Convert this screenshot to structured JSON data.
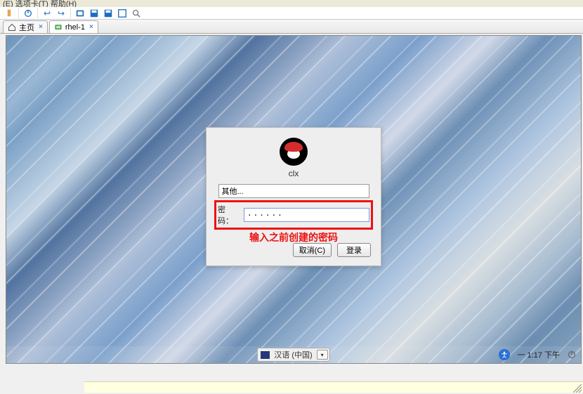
{
  "menubar": {
    "partial_text": "(E)  选项卡(T)  帮助(H)"
  },
  "toolbar": {
    "icons": [
      "pause-icon",
      "divider",
      "power-icon",
      "divider",
      "arrow-left-icon",
      "arrow-right-icon",
      "divider",
      "screenshot-icon",
      "disk-icon",
      "disk-icon",
      "expand-icon",
      "settings-icon"
    ]
  },
  "tabs": [
    {
      "label": "主页",
      "icon": "home-icon",
      "active": false,
      "closable": true
    },
    {
      "label": "rhel-1",
      "icon": "vm-icon",
      "active": true,
      "closable": true
    }
  ],
  "login": {
    "username": "clx",
    "other_input_value": "其他...",
    "password_label": "密码：",
    "password_value": "······",
    "annotation": "输入之前创建的密码",
    "cancel_label": "取消(C)",
    "login_label": "登录"
  },
  "lang": {
    "label": "汉语 (中国)"
  },
  "clock": {
    "text": "一  1:17 下午"
  }
}
